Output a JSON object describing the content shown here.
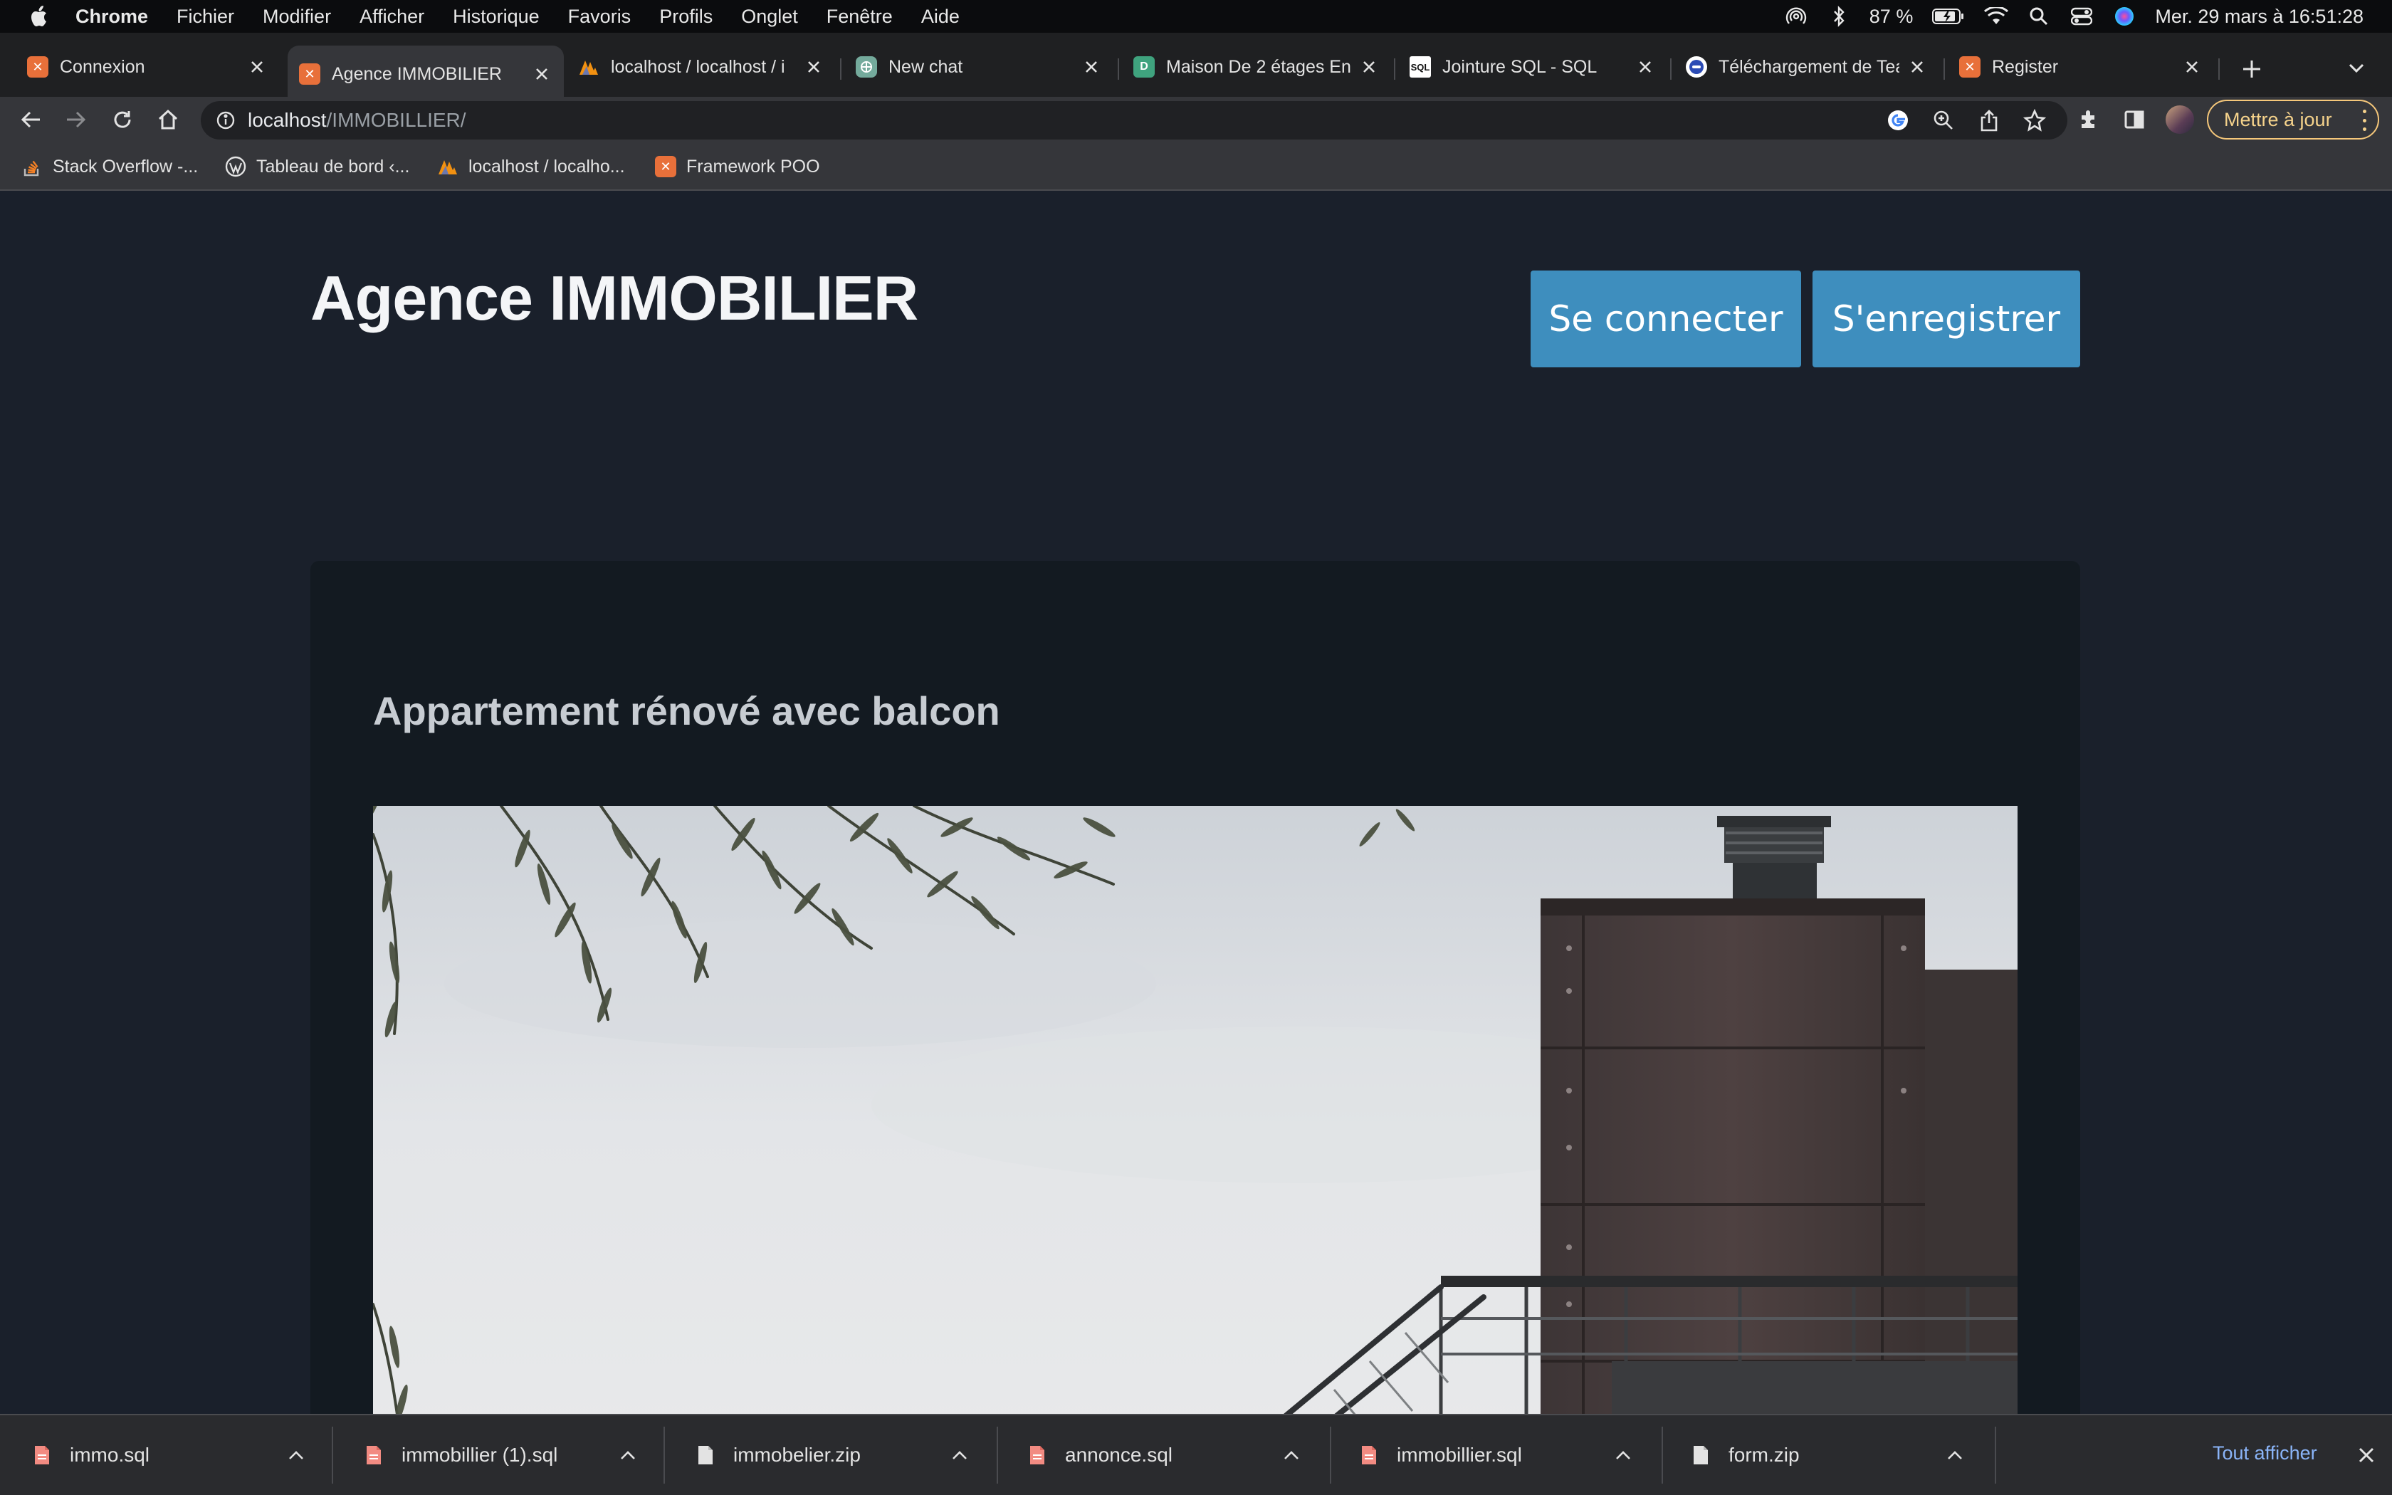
{
  "menubar": {
    "app_name": "Chrome",
    "items": [
      "Fichier",
      "Modifier",
      "Afficher",
      "Historique",
      "Favoris",
      "Profils",
      "Onglet",
      "Fenêtre",
      "Aide"
    ],
    "battery": "87 %",
    "datetime": "Mer. 29 mars à 16:51:28"
  },
  "tabs": [
    {
      "title": "Connexion",
      "icon": "xampp-icon",
      "color": "#e8703a"
    },
    {
      "title": "Agence IMMOBILIER",
      "icon": "xampp-icon",
      "color": "#e8703a",
      "active": true
    },
    {
      "title": "localhost / localhost / i",
      "icon": "phpmyadmin-icon",
      "color": "#f29111"
    },
    {
      "title": "New chat",
      "icon": "chatgpt-icon",
      "color": "#74aa9c"
    },
    {
      "title": "Maison De 2 étages En",
      "icon": "site-icon",
      "color": "#3fa37e"
    },
    {
      "title": "Jointure SQL - SQL",
      "icon": "sql-icon",
      "color": "#ffffff"
    },
    {
      "title": "Téléchargement de Tea",
      "icon": "teams-icon",
      "color": "#2b4bb5"
    },
    {
      "title": "Register",
      "icon": "xampp-icon",
      "color": "#e8703a"
    }
  ],
  "address_bar": {
    "host": "localhost",
    "path": "/IMMOBILLIER/"
  },
  "toolbar": {
    "update_label": "Mettre à jour"
  },
  "bookmarks": [
    {
      "label": "Stack Overflow -...",
      "icon": "stackoverflow-icon"
    },
    {
      "label": "Tableau de bord ‹...",
      "icon": "wordpress-icon"
    },
    {
      "label": "localhost / localho...",
      "icon": "phpmyadmin-icon"
    },
    {
      "label": "Framework POO",
      "icon": "xampp-icon"
    }
  ],
  "site": {
    "title": "Agence IMMOBILIER",
    "login_label": "Se connecter",
    "register_label": "S'enregistrer",
    "listing_title": "Appartement rénové avec balcon"
  },
  "downloads": {
    "files": [
      "immo.sql",
      "immobillier (1).sql",
      "immobelier.zip",
      "annonce.sql",
      "immobillier.sql",
      "form.zip"
    ],
    "show_all_label": "Tout afficher"
  },
  "colors": {
    "page_bg": "#1a202b",
    "card_bg": "#131a21",
    "button_blue": "#3e8ebe",
    "update_accent": "#f5c77a"
  }
}
